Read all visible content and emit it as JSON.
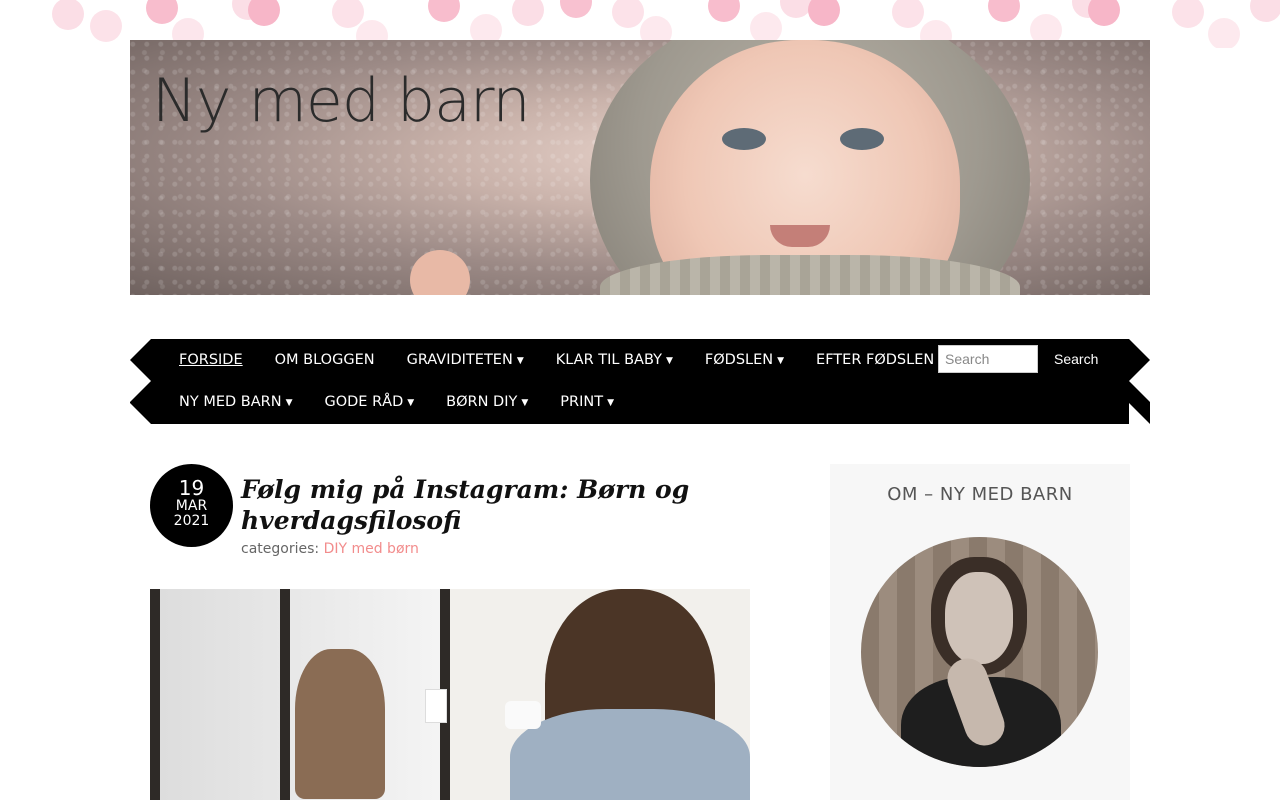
{
  "site": {
    "title": "Ny med barn"
  },
  "nav": {
    "row1": [
      {
        "label": "FORSIDE",
        "caret": "",
        "active": true
      },
      {
        "label": "OM BLOGGEN",
        "caret": ""
      },
      {
        "label": "GRAVIDITETEN",
        "caret": "▼"
      },
      {
        "label": "KLAR TIL BABY",
        "caret": "▼"
      },
      {
        "label": "FØDSLEN",
        "caret": "▼"
      },
      {
        "label": "EFTER FØDSLEN",
        "caret": "▼"
      }
    ],
    "row2": [
      {
        "label": "NY MED BARN",
        "caret": "▼"
      },
      {
        "label": "GODE RÅD",
        "caret": "▼"
      },
      {
        "label": "BØRN DIY",
        "caret": "▼"
      },
      {
        "label": "PRINT",
        "caret": "▼"
      }
    ],
    "search": {
      "placeholder": "Search",
      "button_label": "Search"
    }
  },
  "post": {
    "date": {
      "day": "19",
      "month": "MAR",
      "year": "2021"
    },
    "title": "Følg mig på Instagram: Børn og hverdagsfilosofi",
    "meta_prefix": "categories: ",
    "category": "DIY med børn"
  },
  "sidebar": {
    "heading": "OM – NY MED BARN",
    "intro": ""
  },
  "colors": {
    "nav_bg": "#000000",
    "accent_link": "#f28c8c",
    "dot_pink": "#f7b6c8",
    "sidebar_bg": "#f7f7f7"
  }
}
